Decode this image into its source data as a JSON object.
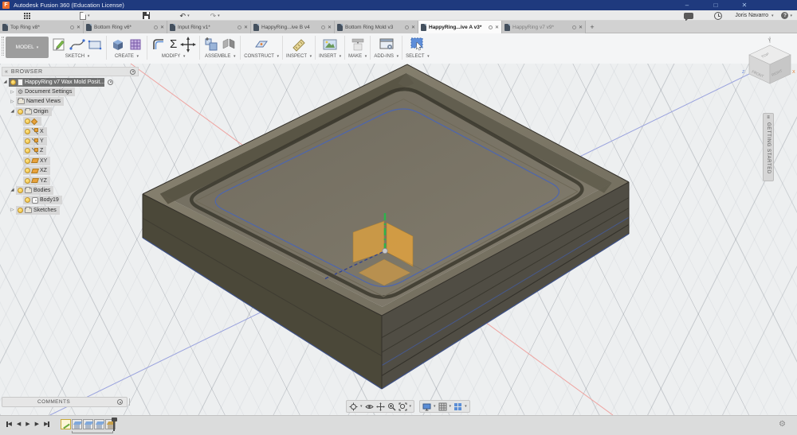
{
  "window": {
    "title": "Autodesk Fusion 360 (Education License)"
  },
  "glyphs": {
    "logo_letter": "F",
    "win_min": "–",
    "win_max": "□",
    "win_close": "✕",
    "caret_down": "▾",
    "undo": "↶",
    "redo": "↷",
    "help_q": "?",
    "tab_close": "✕",
    "tab_new": "+",
    "collapse_left": "«",
    "tri_collapsed": "▷",
    "tri_expanded": "◢",
    "gear": "⚙",
    "sigma": "Σ",
    "menu": "≡",
    "tri_left": "◀",
    "tri_right": "▶"
  },
  "qat": {
    "user_name": "Joris Navarro"
  },
  "tabs": {
    "new_tab_label": "+",
    "items": [
      {
        "label": "Top Ring v8*"
      },
      {
        "label": "Bottom Ring v6*"
      },
      {
        "label": "Input Ring v1*"
      },
      {
        "label": "HappyRing...ive B v4"
      },
      {
        "label": "Bottom Ring Mold v3"
      },
      {
        "label": "HappyRing...ive A v3*",
        "active": true
      },
      {
        "label": "HappyRing v7 v9*"
      }
    ]
  },
  "ribbon": {
    "model_label": "MODEL",
    "groups": [
      {
        "label": "SKETCH"
      },
      {
        "label": "CREATE"
      },
      {
        "label": "MODIFY"
      },
      {
        "label": "ASSEMBLE"
      },
      {
        "label": "CONSTRUCT"
      },
      {
        "label": "INSPECT"
      },
      {
        "label": "INSERT"
      },
      {
        "label": "MAKE"
      },
      {
        "label": "ADD-INS"
      },
      {
        "label": "SELECT"
      }
    ]
  },
  "browser": {
    "header_label": "BROWSER",
    "root_label": "HappyRing v7 Wax Mold Posit...",
    "rows": [
      {
        "label": "Document Settings",
        "tri": "▷"
      },
      {
        "label": "Named Views",
        "tri": "▷"
      },
      {
        "label": "Origin",
        "tri": "◢"
      },
      {
        "label": ""
      },
      {
        "label": "X"
      },
      {
        "label": "Y"
      },
      {
        "label": "Z"
      },
      {
        "label": "XY"
      },
      {
        "label": "XZ"
      },
      {
        "label": "YZ"
      },
      {
        "label": "Bodies",
        "tri": "◢"
      },
      {
        "label": "Body19"
      },
      {
        "label": "Sketches",
        "tri": "▷"
      }
    ]
  },
  "viewcube": {
    "faces": {
      "top": "TOP",
      "front": "FRONT",
      "right": "RIGHT"
    },
    "axes": {
      "x": "X",
      "y": "Y",
      "z": "Z"
    }
  },
  "getting_started": {
    "label": "GETTING STARTED"
  },
  "comments": {
    "label": "COMMENTS"
  },
  "icons": {
    "timeline_features": [
      "sketch",
      "extrude",
      "extrude",
      "extrude",
      "boundary-fill"
    ],
    "nav_bar": [
      "orbit",
      "look-at",
      "pan",
      "zoom",
      "fit",
      "display-settings",
      "grid-snaps",
      "viewports"
    ]
  },
  "colors": {
    "titlebar": "#1f3a7e",
    "logo_orange": "#ef6f2e",
    "axis_x_red": "#efa3a0",
    "axis_y_blue": "#9aa3de",
    "axis_z_green": "#2eb34b",
    "origin_plane_orange": "#e0a23f",
    "body_olive": "#4b4839",
    "edge_highlight_blue": "#4e66ad"
  }
}
